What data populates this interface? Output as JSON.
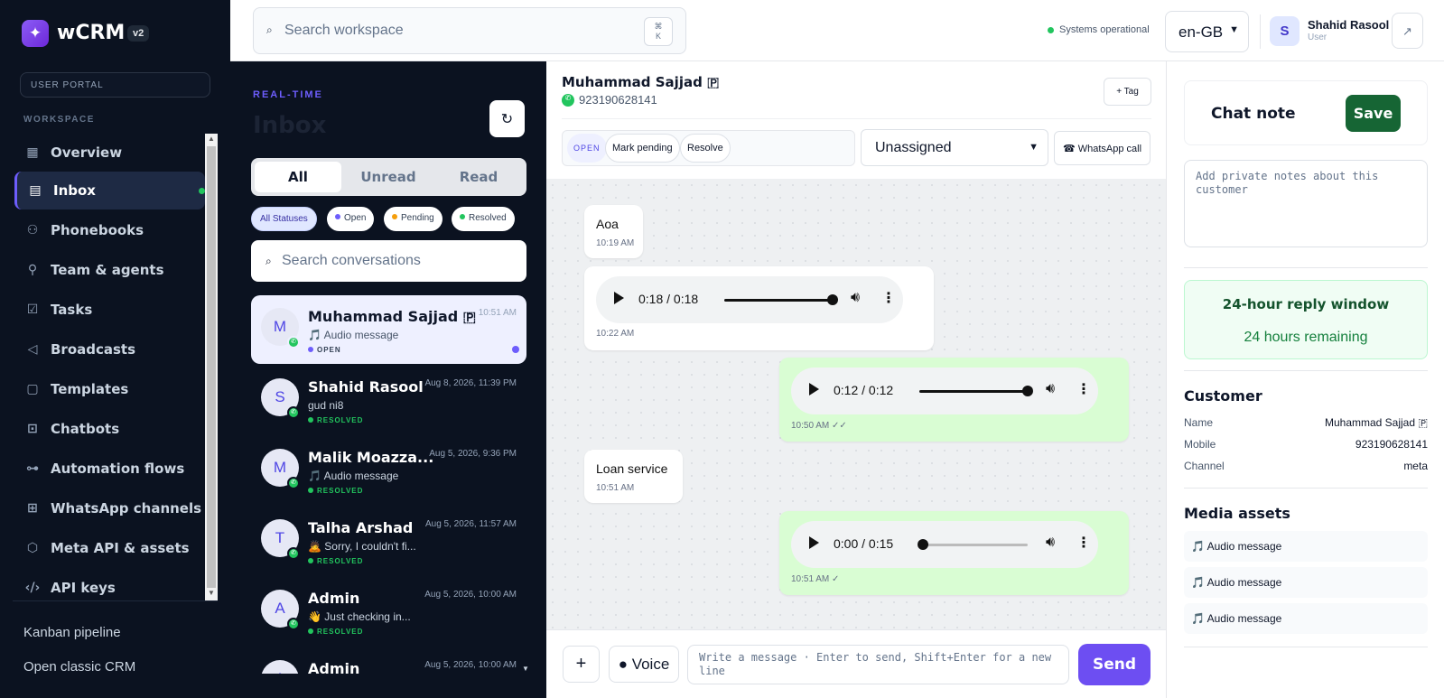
{
  "app": {
    "name": "wCRM",
    "version": "v2",
    "portal": "USER PORTAL",
    "workspace_label": "WORKSPACE"
  },
  "nav": [
    {
      "label": "Overview",
      "icon": "grid-icon"
    },
    {
      "label": "Inbox",
      "icon": "chat-icon"
    },
    {
      "label": "Phonebooks",
      "icon": "users-icon"
    },
    {
      "label": "Team & agents",
      "icon": "user-plus-icon"
    },
    {
      "label": "Tasks",
      "icon": "check-square-icon"
    },
    {
      "label": "Broadcasts",
      "icon": "megaphone-icon"
    },
    {
      "label": "Templates",
      "icon": "file-icon"
    },
    {
      "label": "Chatbots",
      "icon": "robot-icon"
    },
    {
      "label": "Automation flows",
      "icon": "flow-icon"
    },
    {
      "label": "WhatsApp channels",
      "icon": "plus-square-icon"
    },
    {
      "label": "Meta API & assets",
      "icon": "cube-icon"
    },
    {
      "label": "API keys",
      "icon": "code-icon"
    }
  ],
  "footer_links": {
    "kanban": "Kanban pipeline",
    "classic": "Open classic CRM"
  },
  "header": {
    "search_placeholder": "Search workspace",
    "shortcut_top": "⌘",
    "shortcut_bottom": "K",
    "status": "Systems operational",
    "language": "en-GB",
    "user": {
      "initial": "S",
      "name": "Shahid Rasool",
      "role": "User"
    }
  },
  "inbox": {
    "eyebrow": "REAL-TIME",
    "title": "Inbox",
    "tabs": [
      "All",
      "Unread",
      "Read"
    ],
    "filters": [
      {
        "label": "All Statuses"
      },
      {
        "label": "Open",
        "color": "#6d5dfc"
      },
      {
        "label": "Pending",
        "color": "#f59e0b"
      },
      {
        "label": "Resolved",
        "color": "#22c55e"
      }
    ],
    "search_placeholder": "Search conversations",
    "conversations": [
      {
        "initial": "M",
        "name": "Muhammad Sajjad 🇵",
        "preview": "🎵 Audio message",
        "status": "OPEN",
        "time": "10:51 AM"
      },
      {
        "initial": "S",
        "name": "Shahid Rasool",
        "preview": "gud ni8",
        "status": "RESOLVED",
        "time": "Aug 8, 2026, 11:39 PM"
      },
      {
        "initial": "M",
        "name": "Malik Moazza...",
        "preview": "🎵 Audio message",
        "status": "RESOLVED",
        "time": "Aug 5, 2026, 9:36 PM"
      },
      {
        "initial": "T",
        "name": "Talha Arshad",
        "preview": "🙇 Sorry, I couldn't fi...",
        "status": "RESOLVED",
        "time": "Aug 5, 2026, 11:57 AM"
      },
      {
        "initial": "A",
        "name": "Admin",
        "preview": "👋 Just checking in...",
        "status": "RESOLVED",
        "time": "Aug 5, 2026, 10:00 AM"
      },
      {
        "initial": "A",
        "name": "Admin",
        "preview": "",
        "status": "",
        "time": "Aug 5, 2026, 10:00 AM"
      }
    ]
  },
  "chat": {
    "contact_name": "Muhammad Sajjad 🇵",
    "phone": "923190628141",
    "tag_button": "+ Tag",
    "status_pill": "OPEN",
    "mark_pending": "Mark pending",
    "resolve": "Resolve",
    "assignee": "Unassigned",
    "call_button": "☎ WhatsApp call",
    "messages": [
      {
        "dir": "in",
        "type": "text",
        "text": "Aoa",
        "time": "10:19 AM"
      },
      {
        "dir": "in",
        "type": "audio",
        "audio_time": "0:18 / 0:18",
        "progress": 1.0,
        "time": "10:22 AM"
      },
      {
        "dir": "out",
        "type": "audio",
        "audio_time": "0:12 / 0:12",
        "progress": 1.0,
        "time": "10:50 AM ✓✓"
      },
      {
        "dir": "in",
        "type": "text",
        "text": "Loan service",
        "time": "10:51 AM"
      },
      {
        "dir": "out",
        "type": "audio",
        "audio_time": "0:00 / 0:15",
        "progress": 0.0,
        "time": "10:51 AM ✓"
      }
    ],
    "composer": {
      "voice": "● Voice",
      "placeholder": "Write a message · Enter to send, Shift+Enter for a new line",
      "send": "Send"
    }
  },
  "panel": {
    "note_title": "Chat note",
    "save": "Save",
    "note_placeholder": "Add private notes about this customer",
    "reply_window_title": "24-hour reply window",
    "reply_window_remaining": "24 hours remaining",
    "customer_title": "Customer",
    "customer": [
      {
        "label": "Name",
        "value": "Muhammad Sajjad 🇵"
      },
      {
        "label": "Mobile",
        "value": "923190628141"
      },
      {
        "label": "Channel",
        "value": "meta"
      }
    ],
    "media_title": "Media assets",
    "media": [
      "🎵 Audio message",
      "🎵 Audio message",
      "🎵 Audio message"
    ]
  }
}
